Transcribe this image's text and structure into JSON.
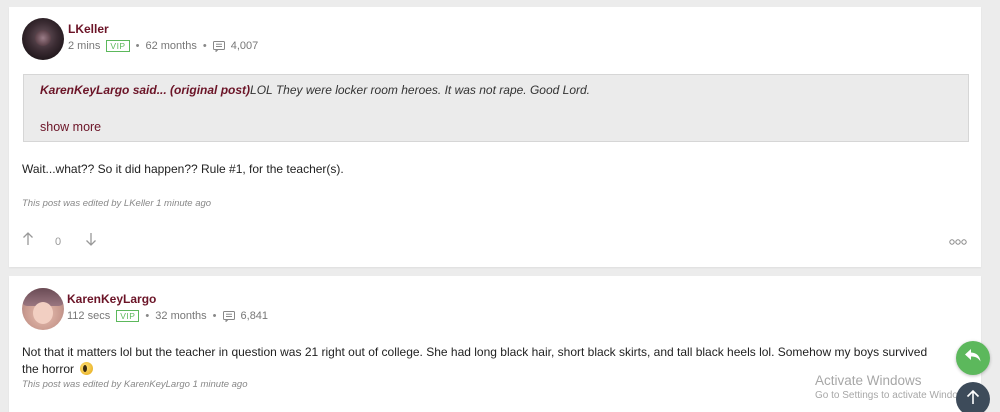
{
  "posts": [
    {
      "username": "LKeller",
      "time": "2 mins",
      "vip": "VIP",
      "tenure": "62 months",
      "post_count": "4,007",
      "quote": {
        "author": "KarenKeyLargo said... (original post)",
        "text": "LOL They were locker room heroes. It was not rape. Good Lord.",
        "show_more": "show more"
      },
      "body": "Wait...what?? So it did happen?? Rule #1, for the teacher(s).",
      "edited": "This post was edited by LKeller 1 minute ago",
      "votes": "0"
    },
    {
      "username": "KarenKeyLargo",
      "time": "112 secs",
      "vip": "VIP",
      "tenure": "32 months",
      "post_count": "6,841",
      "body_line1": "Not that it matters lol but the teacher in question was 21 right out of college. She had long black hair, short black skirts, and tall black heels lol. Somehow my boys survived",
      "body_line2": "the horror",
      "edited": "This post was edited by KarenKeyLargo 1 minute ago"
    }
  ],
  "overlay": {
    "activate_title": "Activate Windows",
    "activate_sub": "Go to Settings to activate Windows."
  },
  "colors": {
    "username": "#6b1427",
    "vip": "#5cb85c",
    "reply_fab": "#5cb85c",
    "top_fab": "#3d4b5a"
  },
  "icons": [
    "comment-icon",
    "arrow-up-icon",
    "arrow-down-icon",
    "more-options-icon",
    "reply-icon",
    "scroll-top-icon",
    "emoji-icon"
  ]
}
